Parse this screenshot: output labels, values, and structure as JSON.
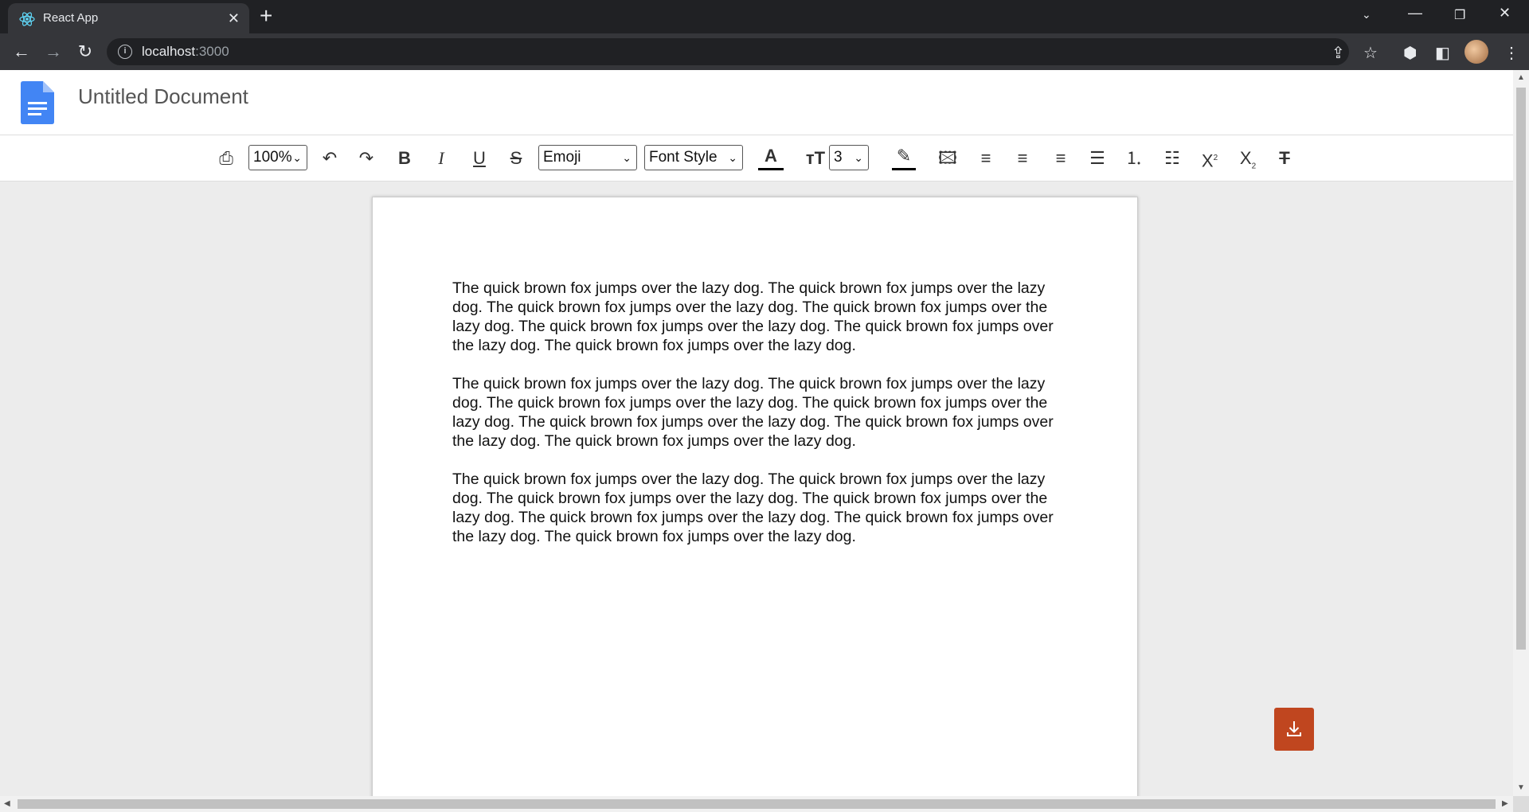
{
  "browser": {
    "tab_title": "React App",
    "url_host": "localhost",
    "url_port": ":3000"
  },
  "app": {
    "doc_title": "Untitled Document"
  },
  "toolbar": {
    "zoom": "100%",
    "emoji_select": "Emoji",
    "font_style_select": "Font Style",
    "font_size_select": "3",
    "bold_label": "B",
    "italic_label": "I",
    "underline_label": "U",
    "strike_label": "S",
    "superscript_label": "X",
    "subscript_label": "X"
  },
  "document": {
    "paragraphs": [
      "The quick brown fox jumps over the lazy dog. The quick brown fox jumps over the lazy dog. The quick brown fox jumps over the lazy dog. The quick brown fox jumps over the lazy dog. The quick brown fox jumps over the lazy dog. The quick brown fox jumps over the lazy dog. The quick brown fox jumps over the lazy dog.",
      "The quick brown fox jumps over the lazy dog. The quick brown fox jumps over the lazy dog. The quick brown fox jumps over the lazy dog. The quick brown fox jumps over the lazy dog. The quick brown fox jumps over the lazy dog. The quick brown fox jumps over the lazy dog. The quick brown fox jumps over the lazy dog.",
      "The quick brown fox jumps over the lazy dog. The quick brown fox jumps over the lazy dog. The quick brown fox jumps over the lazy dog. The quick brown fox jumps over the lazy dog. The quick brown fox jumps over the lazy dog. The quick brown fox jumps over the lazy dog. The quick brown fox jumps over the lazy dog."
    ]
  },
  "colors": {
    "brand_blue": "#4285f4",
    "download_button": "#c0461f"
  }
}
